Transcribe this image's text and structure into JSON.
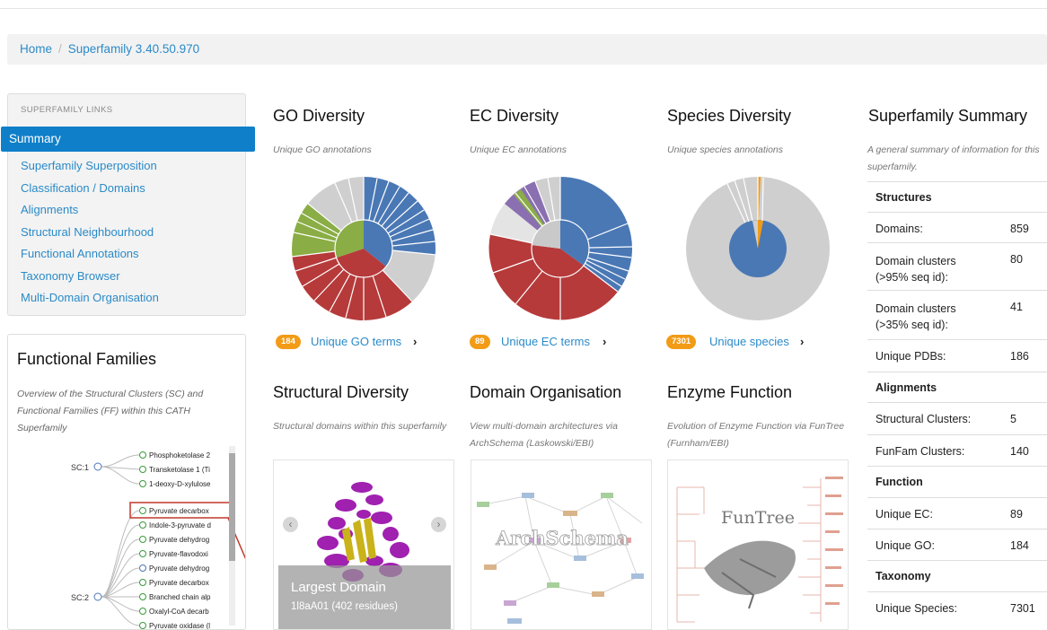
{
  "breadcrumb": {
    "home": "Home",
    "current": "Superfamily 3.40.50.970"
  },
  "sidebar": {
    "header": "SUPERFAMILY LINKS",
    "active": "Summary",
    "links": [
      "Superfamily Superposition",
      "Classification / Domains",
      "Alignments",
      "Structural Neighbourhood",
      "Functional Annotations",
      "Taxonomy Browser",
      "Multi-Domain Organisation"
    ]
  },
  "functional_families": {
    "title": "Functional Families",
    "description": "Overview of the Structural Clusters (SC) and Functional Families (FF) within this CATH Superfamily",
    "sc_labels": [
      "SC:1",
      "SC:2"
    ],
    "leaves": [
      "Phosphoketolase 2",
      "Transketolase 1 (Ti",
      "1-deoxy-D-xylulose",
      "Pyruvate decarbox",
      "Indole-3-pyruvate d",
      "Pyruvate dehydrog",
      "Pyruvate-flavodoxi",
      "Pyruvate dehydrog",
      "Pyruvate decarbox",
      "Branched chain alp",
      "Oxalyl-CoA decarb",
      "Pyruvate oxidase (l"
    ]
  },
  "go": {
    "title": "GO Diversity",
    "subtitle": "Unique GO annotations",
    "count": "184",
    "link": "Unique GO terms"
  },
  "ec": {
    "title": "EC Diversity",
    "subtitle": "Unique EC annotations",
    "count": "89",
    "link": "Unique EC terms"
  },
  "species": {
    "title": "Species Diversity",
    "subtitle": "Unique species annotations",
    "count": "7301",
    "link": "Unique species"
  },
  "structural": {
    "title": "Structural Diversity",
    "subtitle": "Structural domains within this superfamily",
    "caption_title": "Largest Domain",
    "caption_sub": "1l8aA01 (402 residues)"
  },
  "domain_org": {
    "title": "Domain Organisation",
    "subtitle": "View multi-domain architectures via ArchSchema (Laskowski/EBI)",
    "watermark": "ArchSchema"
  },
  "enzyme": {
    "title": "Enzyme Function",
    "subtitle": "Evolution of Enzyme Function via FunTree (Furnham/EBI)",
    "watermark": "FunTree"
  },
  "summary": {
    "title": "Superfamily Summary",
    "subtitle": "A general summary of information for this superfamily.",
    "structures_header": "Structures",
    "domains_label": "Domains:",
    "domains_value": "859",
    "clusters95_label": "Domain clusters (>95% seq id):",
    "clusters95_value": "80",
    "clusters35_label": "Domain clusters (>35% seq id):",
    "clusters35_value": "41",
    "pdbs_label": "Unique PDBs:",
    "pdbs_value": "186",
    "alignments_header": "Alignments",
    "sc_label": "Structural Clusters:",
    "sc_value": "5",
    "funfam_label": "FunFam Clusters:",
    "funfam_value": "140",
    "function_header": "Function",
    "ec_label": "Unique EC:",
    "ec_value": "89",
    "go_label": "Unique GO:",
    "go_value": "184",
    "taxonomy_header": "Taxonomy",
    "species_label": "Unique Species:",
    "species_value": "7301"
  },
  "colors": {
    "blue": "#4a78b5",
    "red": "#b63a3a",
    "green": "#8aad45",
    "grey": "#cfcfcf",
    "orange": "#f29b16",
    "link": "#2a8ac8",
    "active": "#0f7fc9"
  }
}
